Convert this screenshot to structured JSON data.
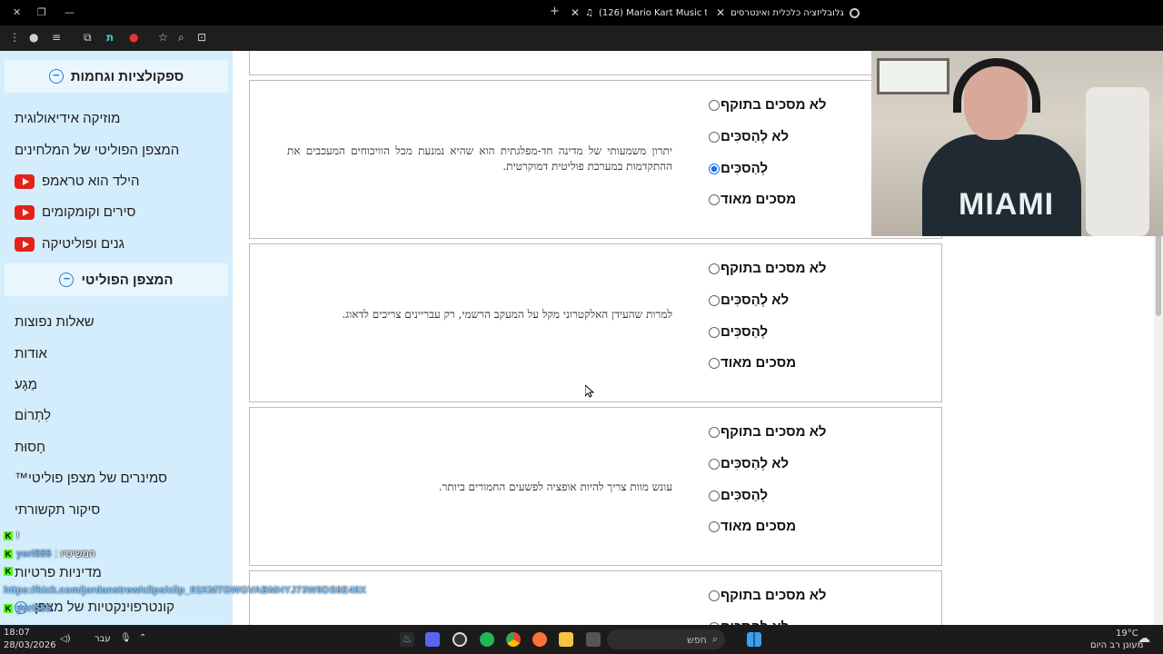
{
  "browser": {
    "tabs": [
      {
        "title": "(126) Mario Kart Music to S"
      },
      {
        "title": "גלובליזציה כלכלית ואינטרסים"
      }
    ],
    "new_tab": "+"
  },
  "sidebar": {
    "section1": {
      "title": "ספקולציות וגחמות"
    },
    "items1": [
      {
        "label": "מוזיקה אידיאולוגית",
        "youtube": false
      },
      {
        "label": "המצפן הפוליטי של המלחינים",
        "youtube": false
      },
      {
        "label": "הילד הוא טראמפ",
        "youtube": true
      },
      {
        "label": "סירים וקומקומים",
        "youtube": true
      },
      {
        "label": "גנים ופוליטיקה",
        "youtube": true
      }
    ],
    "section2": {
      "title": "המצפן הפוליטי"
    },
    "items2": [
      {
        "label": "שאלות נפוצות"
      },
      {
        "label": "אודות"
      },
      {
        "label": "מַגָע"
      },
      {
        "label": "לִתְרוֹם"
      },
      {
        "label": "חָסוּת"
      },
      {
        "label": "סמינרים של מצפן פוליטי™"
      },
      {
        "label": "סיקור תקשורתי"
      },
      {
        "label": "מדיניות פרטיות"
      },
      {
        "label": "קונטרפוינקטיות של מצפן"
      }
    ]
  },
  "questions": [
    {
      "text": "יתרון משמעותי של מדינה חד-מפלגתית הוא שהיא נמנעת מכל הוויכוחים המעכבים את ההתקדמות במערכת פוליטית דמוקרטית.",
      "selected": 2
    },
    {
      "text": "למרות שהעידן האלקטרוני מקל על המעקב הרשמי, רק עבריינים צריכים לדאוג.",
      "selected": -1
    },
    {
      "text": "עונש מוות צריך להיות אופציה לפשעים החמורים ביותר.",
      "selected": -1
    }
  ],
  "options": [
    "לא מסכים בתוקף",
    "לא לְהַסכִּים",
    "לְהַסכִּים",
    "מסכים מאוד"
  ],
  "chat": {
    "lines": [
      {
        "user": "",
        "msg": "!"
      },
      {
        "user": "yori555",
        "msg": ": המשיטיו"
      },
      {
        "user": "",
        "msg": ""
      },
      {
        "user": "yori555",
        "msg": ""
      }
    ],
    "link": "https://kick.com/jordanstrew/clips/clip_01KMTGWGVABMHYJ73W9DS6E48X"
  },
  "webcam": {
    "shirt_text": "MIAMI"
  },
  "taskbar": {
    "search": "חפש",
    "lang": "עבר",
    "time": "18:07",
    "date": "28/03/2026",
    "temp": "19°C",
    "weather": "מעונן רב היום"
  }
}
